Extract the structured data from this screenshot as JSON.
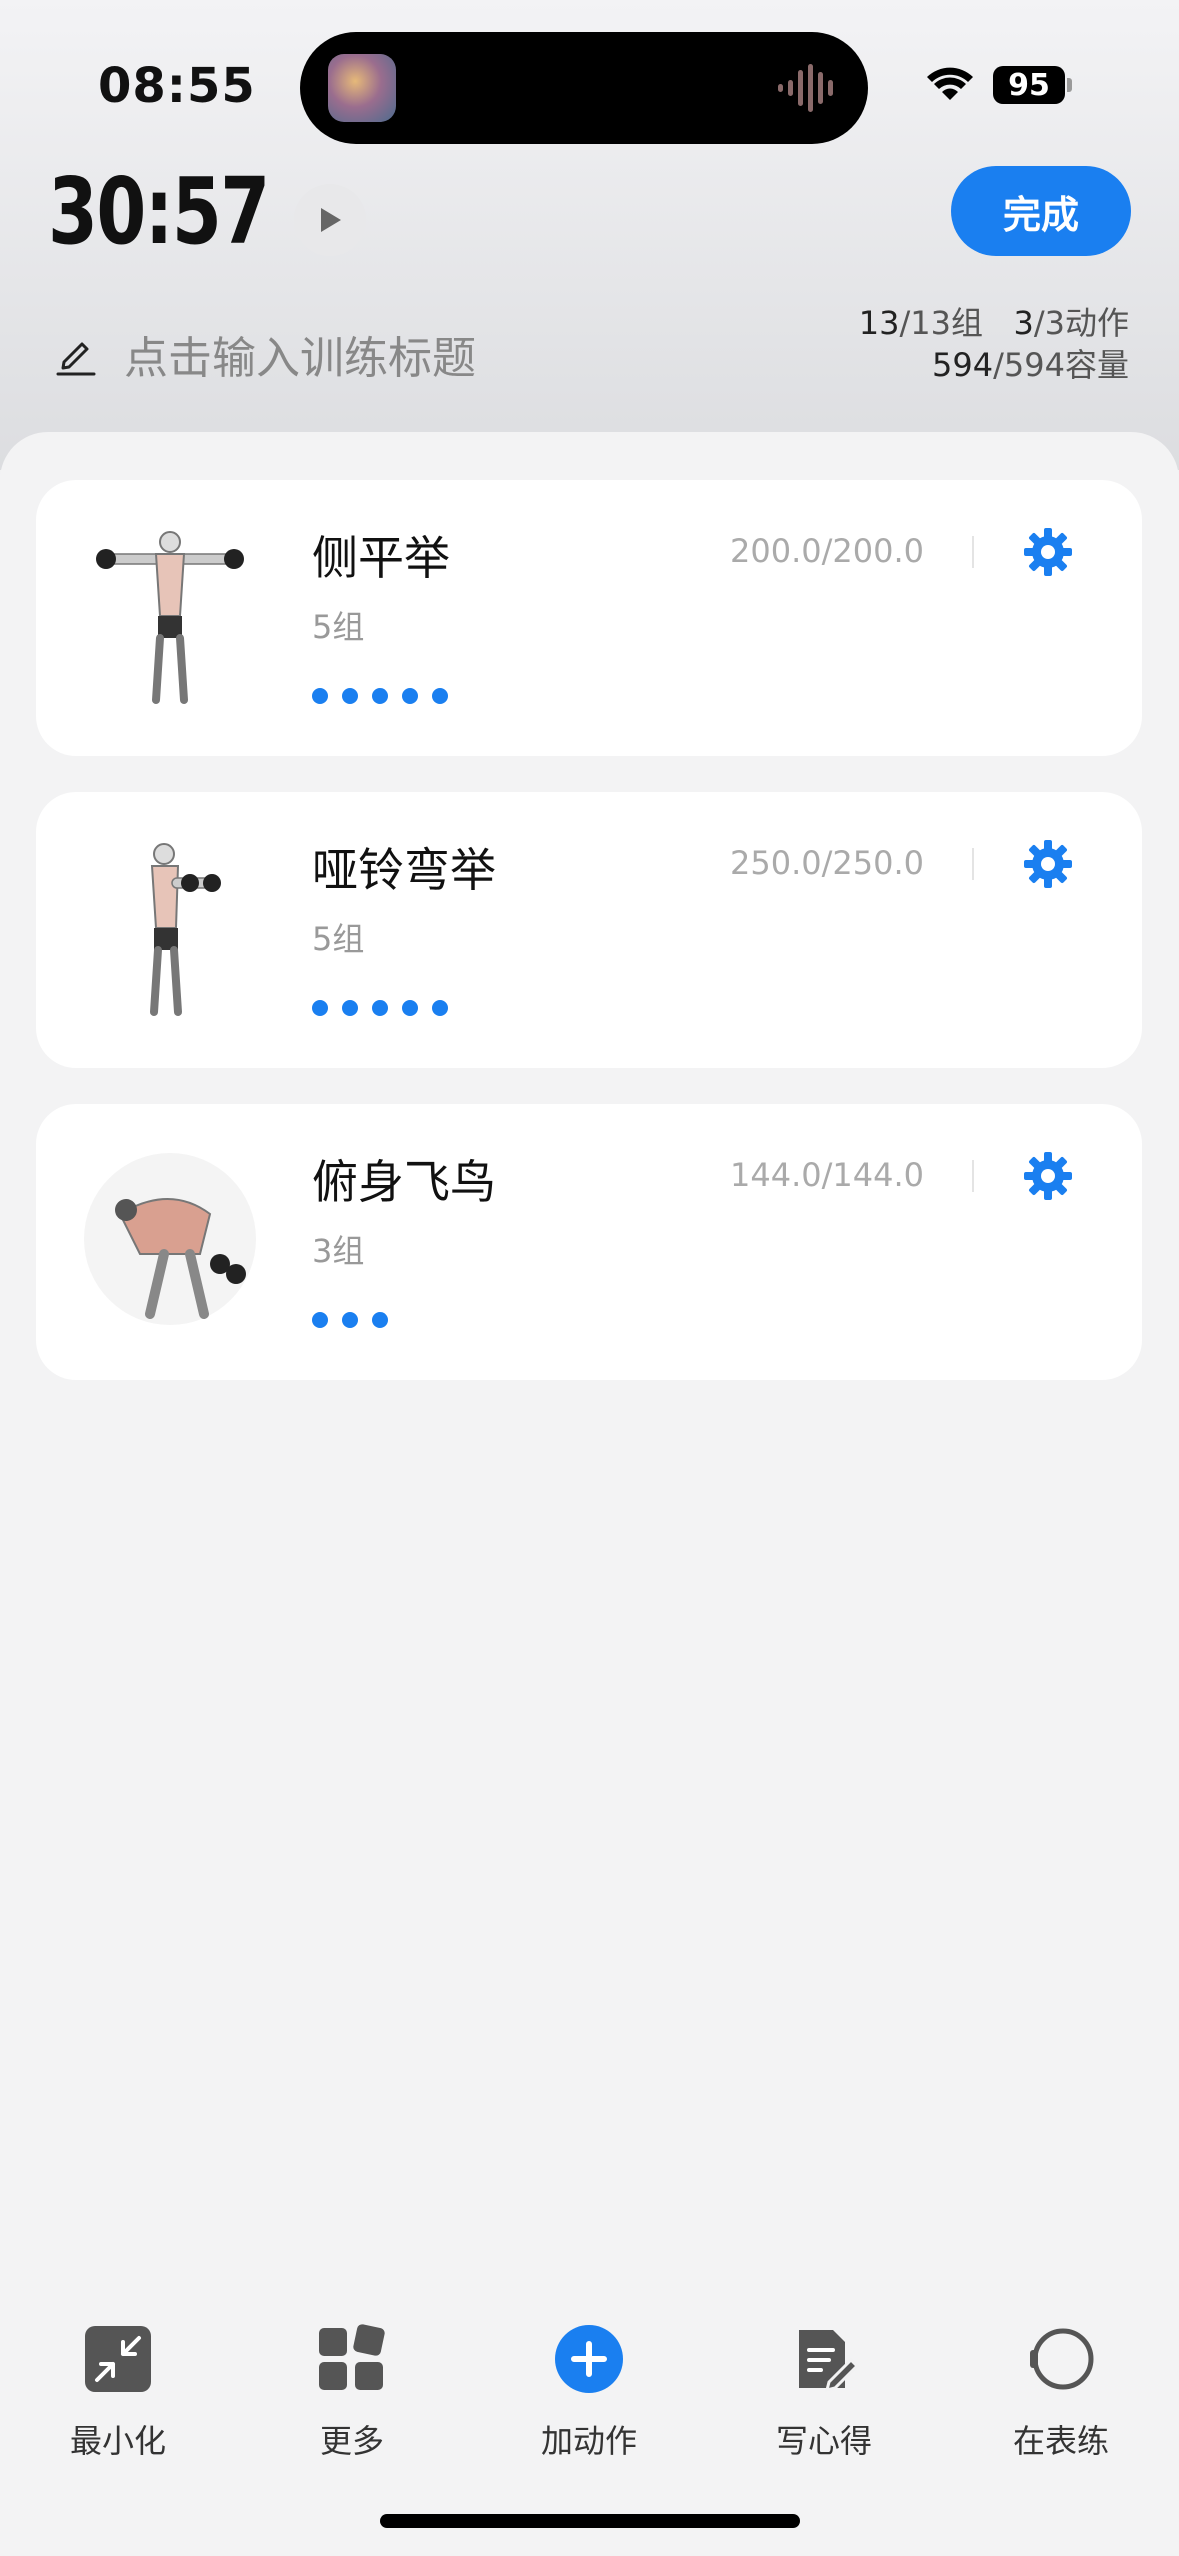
{
  "status_bar": {
    "time": "08:55",
    "battery": "95"
  },
  "header": {
    "timer": "30:57",
    "done_label": "完成",
    "title_placeholder": "点击输入训练标题",
    "sets_done": "13",
    "sets_total": "/13组",
    "actions_done": "3",
    "actions_total": "/3动作",
    "volume_done": "594",
    "volume_total": "/594容量"
  },
  "exercises": [
    {
      "name": "侧平举",
      "sets": "5组",
      "volume": "200.0/200.0",
      "dot_count": 5
    },
    {
      "name": "哑铃弯举",
      "sets": "5组",
      "volume": "250.0/250.0",
      "dot_count": 5
    },
    {
      "name": "俯身飞鸟",
      "sets": "3组",
      "volume": "144.0/144.0",
      "dot_count": 3
    }
  ],
  "tabbar": {
    "minimize": "最小化",
    "more": "更多",
    "add_action": "加动作",
    "notes": "写心得",
    "watch": "在表练"
  },
  "colors": {
    "accent": "#1a7ff0"
  }
}
